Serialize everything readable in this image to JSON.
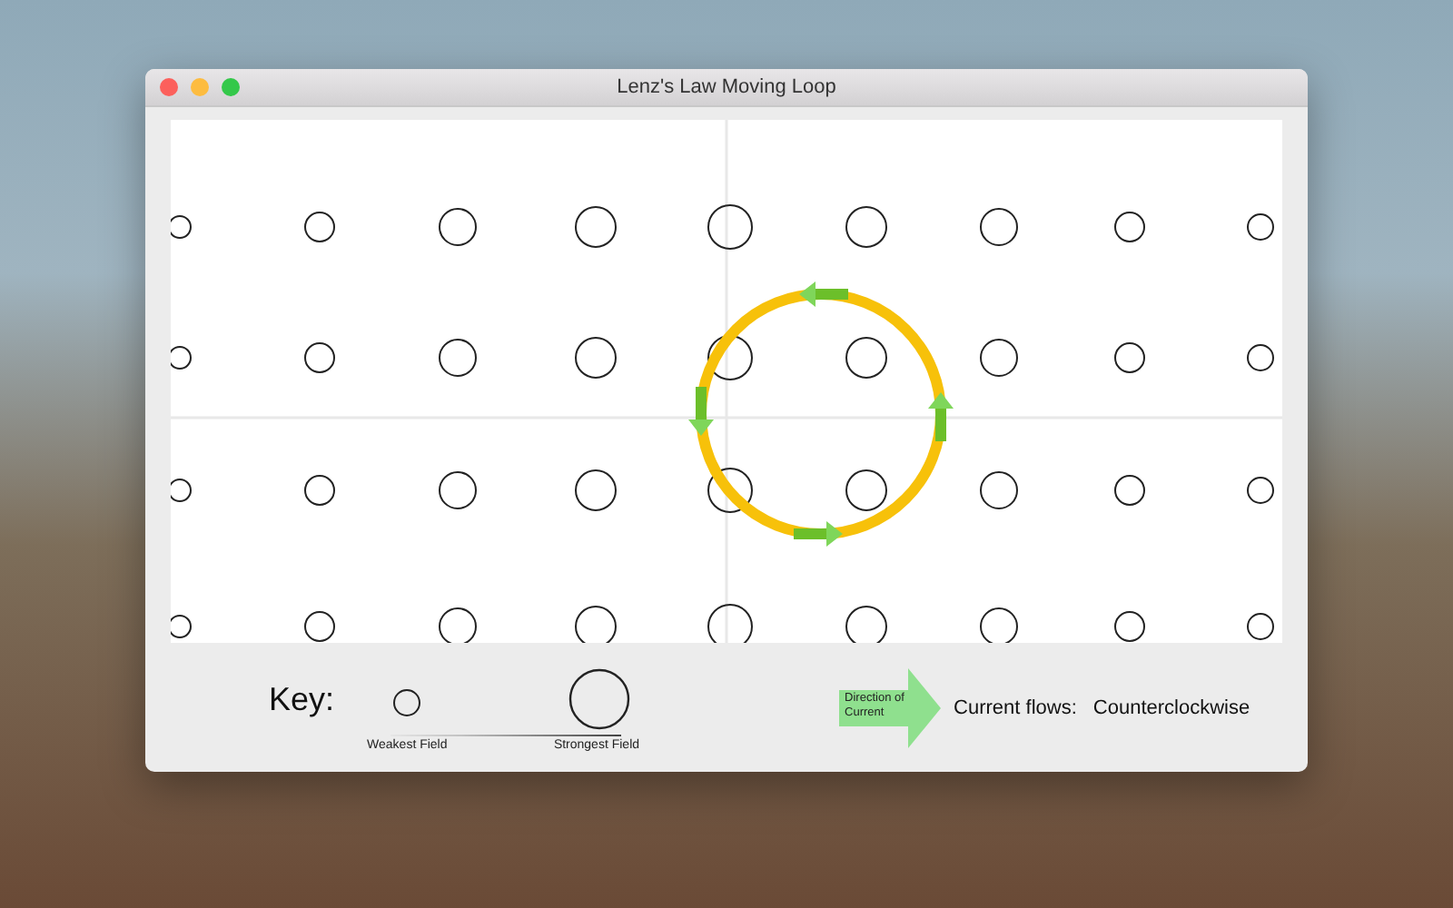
{
  "window": {
    "title": "Lenz's Law Moving Loop"
  },
  "key": {
    "label": "Key:",
    "weakest_label": "Weakest Field",
    "strongest_label": "Strongest  Field"
  },
  "current_arrow": {
    "text": "Direction of Current"
  },
  "current_flows": {
    "label": "Current flows:",
    "value": "Counterclockwise"
  }
}
